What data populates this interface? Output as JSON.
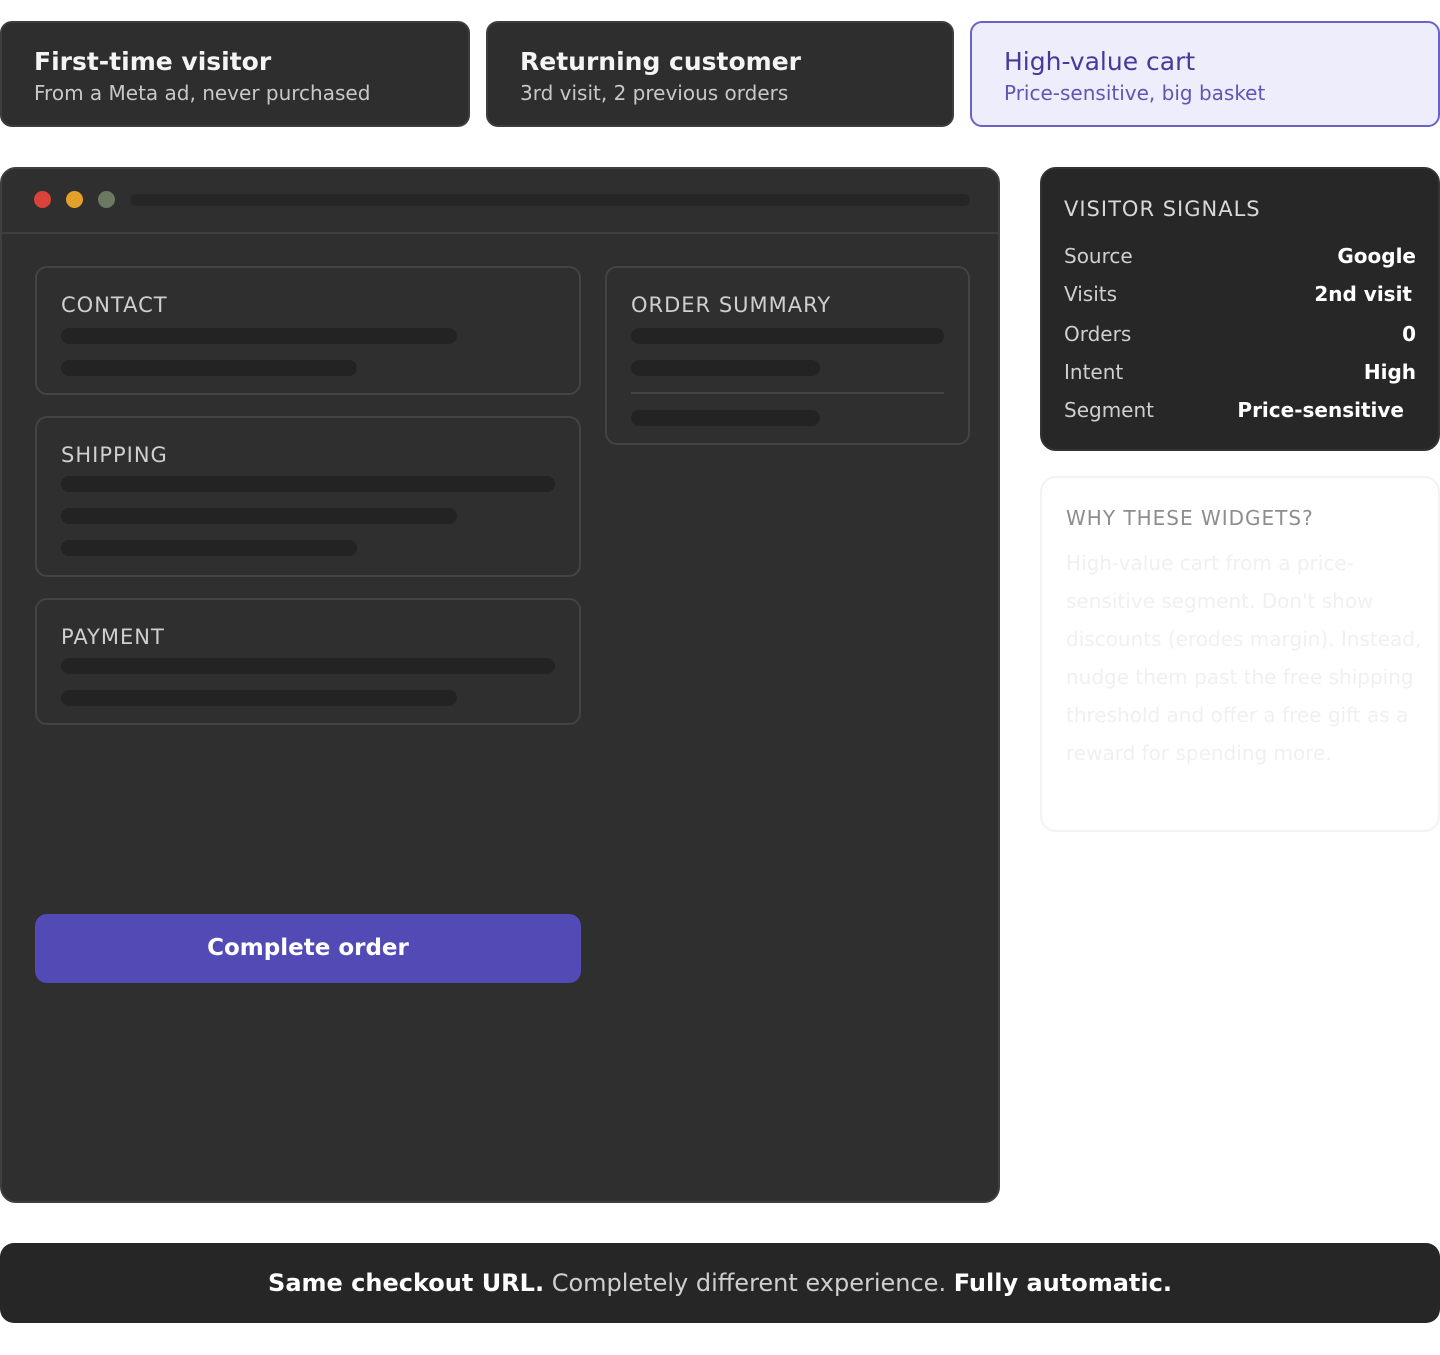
{
  "personas": [
    {
      "title": "First-time visitor",
      "subtitle": "From a Meta ad, never purchased",
      "active": false
    },
    {
      "title": "Returning customer",
      "subtitle": "3rd visit, 2 previous orders",
      "active": false
    },
    {
      "title": "High-value cart",
      "subtitle": "Price-sensitive, big basket",
      "active": true
    }
  ],
  "checkout": {
    "contact_title": "CONTACT",
    "shipping_title": "SHIPPING",
    "payment_title": "PAYMENT",
    "summary_title": "ORDER SUMMARY",
    "complete_label": "Complete order"
  },
  "signals": {
    "title": "VISITOR SIGNALS",
    "rows": [
      {
        "label": "Source",
        "value": "Google"
      },
      {
        "label": "Visits",
        "value": "2nd visit"
      },
      {
        "label": "Orders",
        "value": "0"
      },
      {
        "label": "Intent",
        "value": "High"
      },
      {
        "label": "Segment",
        "value": "Price-sensitive"
      }
    ]
  },
  "why": {
    "title": "WHY THESE WIDGETS?",
    "body": "High-value cart from a price-sensitive segment. Don't show discounts (erodes margin). Instead, nudge them past the free shipping threshold and offer a free gift as a reward for spending more."
  },
  "footer": {
    "part1": "Same checkout URL.",
    "part2": " Completely different experience. ",
    "part3": "Fully automatic."
  },
  "colors": {
    "accent": "#524ab5",
    "active_tab_bg": "#eeedfc",
    "dark_surface": "#2f2f2f"
  }
}
